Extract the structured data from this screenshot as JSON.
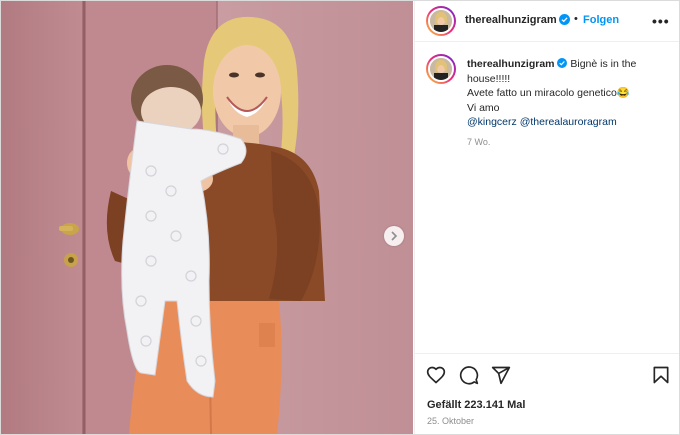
{
  "post": {
    "username": "therealhunzigram",
    "follow_label": "Folgen",
    "separator": "•",
    "more_label": "•••",
    "caption": {
      "line1": "Bignè is in the",
      "line2": "house!!!!!",
      "line3": "Avete fatto un miracolo genetico😂",
      "line4": "Vi amo",
      "mention1": "@kingcerz",
      "mention2": "@therealauroragram"
    },
    "age": "7 Wo.",
    "views": "Gefällt 223.141 Mal",
    "date": "25. Oktober"
  },
  "icons": {
    "verified": "verified-badge-icon",
    "next": "chevron-right-icon",
    "like": "heart-icon",
    "comment": "comment-icon",
    "share": "send-icon",
    "save": "bookmark-icon"
  },
  "colors": {
    "verified": "#0095f6",
    "follow": "#0095f6",
    "mention": "#00376b",
    "wall": "#c4949a",
    "sweater": "#8a4a28",
    "pants": "#e88c5a"
  }
}
